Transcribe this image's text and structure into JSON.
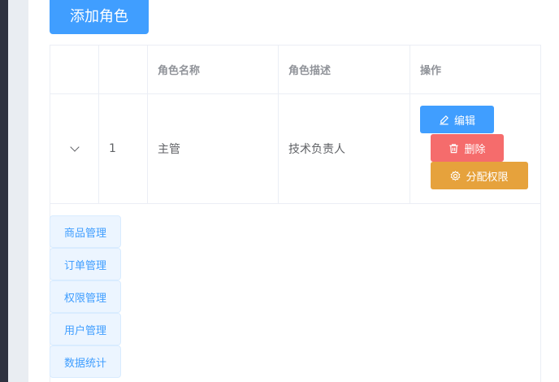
{
  "toolbar": {
    "add_role_label": "添加角色"
  },
  "table": {
    "headers": [
      "",
      "",
      "角色名称",
      "角色描述",
      "操作"
    ],
    "rows": [
      {
        "index": "1",
        "role_name": "主管",
        "role_desc": "技术负责人",
        "actions": {
          "edit": "编辑",
          "delete": "删除",
          "assign": "分配权限"
        }
      }
    ]
  },
  "expanded_permissions": [
    "商品管理",
    "订单管理",
    "权限管理",
    "用户管理",
    "数据统计"
  ],
  "colors": {
    "primary": "#409eff",
    "danger": "#f56c6c",
    "warning": "#e6a23c",
    "tag_bg": "#ecf5ff"
  }
}
